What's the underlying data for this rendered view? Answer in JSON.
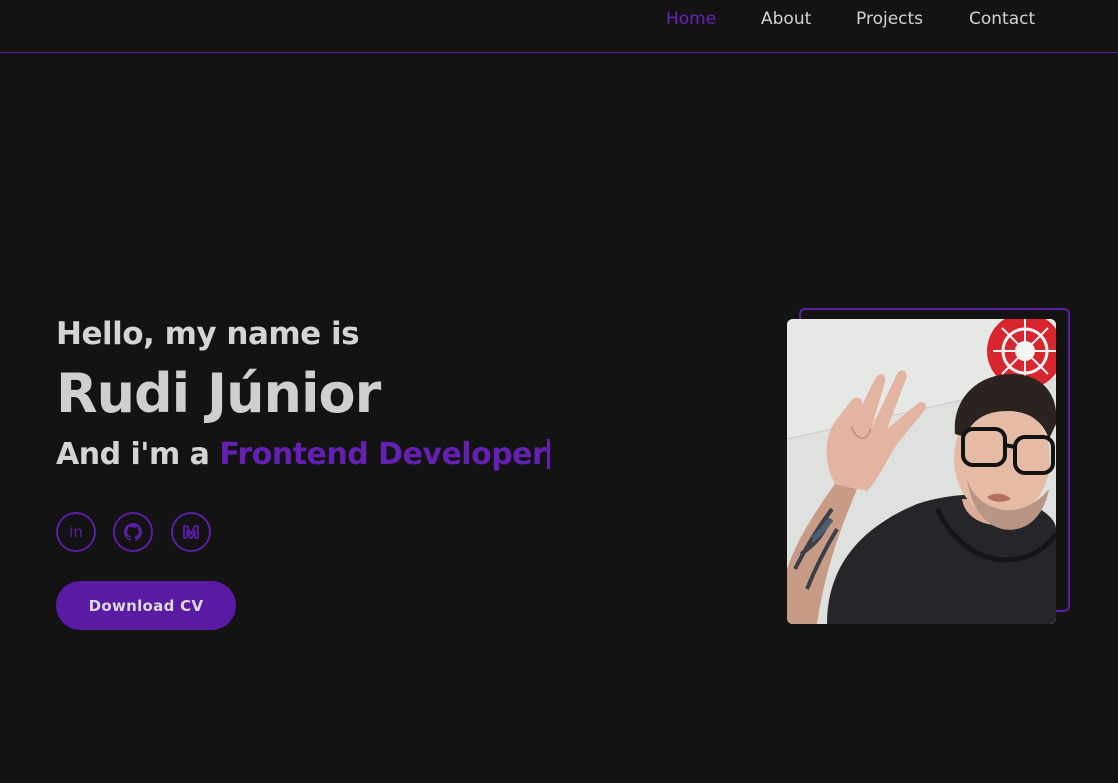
{
  "nav": {
    "items": [
      {
        "label": "Home",
        "active": true
      },
      {
        "label": "About",
        "active": false
      },
      {
        "label": "Projects",
        "active": false
      },
      {
        "label": "Contact",
        "active": false
      }
    ]
  },
  "hero": {
    "greeting": "Hello, my name is",
    "name": "Rudi Júnior",
    "role_prefix": "And i'm a ",
    "role_highlight": "Frontend Developer",
    "cv_button_label": "Download CV"
  },
  "social": [
    {
      "icon": "linkedin-icon",
      "label": "in"
    },
    {
      "icon": "github-icon"
    },
    {
      "icon": "medium-icon"
    }
  ],
  "colors": {
    "background": "#131314",
    "accent": "#5b1aa4",
    "text": "#d4d4d4"
  }
}
